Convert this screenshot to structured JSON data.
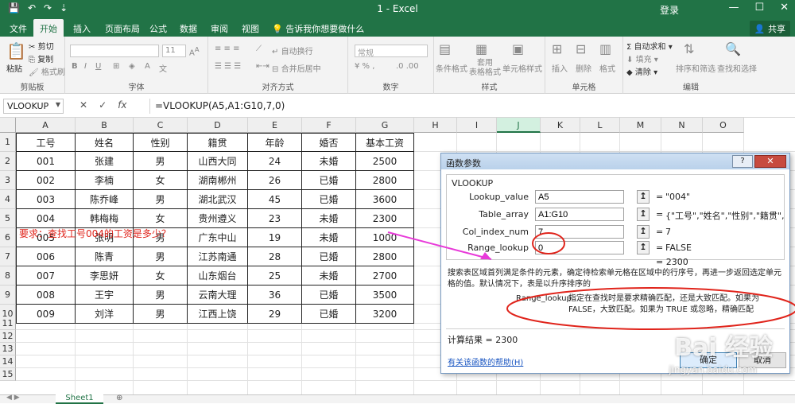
{
  "titlebar": {
    "title": "1  -  Excel",
    "login": "登录",
    "min": "—",
    "max": "☐",
    "close": "✕",
    "save": "💾",
    "undo": "↶",
    "redo": "↷",
    "more": "⇣"
  },
  "tabs": [
    "文件",
    "开始",
    "插入",
    "页面布局",
    "公式",
    "数据",
    "审阅",
    "视图"
  ],
  "tell_me": "告诉我你想要做什么",
  "share": "共享",
  "ribbon": {
    "clipboard": {
      "label": "剪贴板",
      "paste": "粘贴",
      "cut": "剪切",
      "copy": "复制",
      "format_painter": "格式刷"
    },
    "font": {
      "label": "字体",
      "size": "11"
    },
    "alignment": {
      "label": "对齐方式",
      "wrap": "自动换行",
      "merge": "合并后居中"
    },
    "number": {
      "label": "数字",
      "format": "常规"
    },
    "styles": {
      "label": "样式",
      "cond": "条件格式",
      "table": "套用\n表格格式",
      "cell": "单元格样式"
    },
    "cells": {
      "label": "单元格",
      "insert": "插入",
      "delete": "删除",
      "format": "格式"
    },
    "editing": {
      "label": "编辑",
      "autosum": "自动求和",
      "fill": "填充",
      "clear": "清除",
      "sort": "排序和筛选",
      "find": "查找和选择"
    }
  },
  "formula_bar": {
    "name_box": "VLOOKUP",
    "formula": "=VLOOKUP(A5,A1:G10,7,0)"
  },
  "columns": [
    "A",
    "B",
    "C",
    "D",
    "E",
    "F",
    "G",
    "H",
    "I",
    "J",
    "K",
    "L",
    "M",
    "N",
    "O"
  ],
  "rows": [
    "1",
    "2",
    "3",
    "4",
    "5",
    "6",
    "7",
    "8",
    "9",
    "10",
    "11",
    "12",
    "13",
    "14",
    "15"
  ],
  "table": {
    "headers": [
      "工号",
      "姓名",
      "性别",
      "籍贯",
      "年龄",
      "婚否",
      "基本工资"
    ],
    "rows": [
      [
        "001",
        "张建",
        "男",
        "山西大同",
        "24",
        "未婚",
        "2500"
      ],
      [
        "002",
        "李楠",
        "女",
        "湖南郴州",
        "26",
        "已婚",
        "2800"
      ],
      [
        "003",
        "陈乔峰",
        "男",
        "湖北武汉",
        "45",
        "已婚",
        "3600"
      ],
      [
        "004",
        "韩梅梅",
        "女",
        "贵州遵义",
        "23",
        "未婚",
        "2300"
      ],
      [
        "005",
        "张明",
        "男",
        "广东中山",
        "19",
        "未婚",
        "1000"
      ],
      [
        "006",
        "陈青",
        "男",
        "江苏南通",
        "28",
        "已婚",
        "2800"
      ],
      [
        "007",
        "李思妍",
        "女",
        "山东烟台",
        "25",
        "未婚",
        "2700"
      ],
      [
        "008",
        "王宇",
        "男",
        "云南大理",
        "36",
        "已婚",
        "3500"
      ],
      [
        "009",
        "刘洋",
        "男",
        "江西上饶",
        "29",
        "已婚",
        "3200"
      ]
    ]
  },
  "requirement": "要求：查找工号004的工资是多少？",
  "sheet_tab": "Sheet1",
  "dialog": {
    "title": "函数参数",
    "help_btn": "?",
    "close_btn": "✕",
    "function": "VLOOKUP",
    "args": [
      {
        "label": "Lookup_value",
        "input": "A5",
        "value": "\"004\""
      },
      {
        "label": "Table_array",
        "input": "A1:G10",
        "value": "{\"工号\",\"姓名\",\"性别\",\"籍贯\",\"年龄\",\"婚否\"}"
      },
      {
        "label": "Col_index_num",
        "input": "7",
        "value": "7"
      },
      {
        "label": "Range_lookup",
        "input": "0",
        "value": "FALSE"
      }
    ],
    "collapse_icon": "↥",
    "eq": "=",
    "result_line": "= 2300",
    "description": "搜索表区域首列满足条件的元素，确定待检索单元格在区域中的行序号，再进一步返回选定单元格的值。默认情况下，表是以升序排序的",
    "arg_desc_name": "Range_lookup",
    "arg_desc": "指定在查找时是要求精确匹配，还是大致匹配。如果为 FALSE，大致匹配。如果为 TRUE 或忽略，精确匹配",
    "calc_result": "计算结果 =   2300",
    "help_link": "有关该函数的帮助(H)",
    "ok": "确定",
    "cancel": "取消"
  },
  "watermark": {
    "brand": "Bai 经验",
    "url": "jingyan.baidu.com"
  },
  "annotation_colors": {
    "arrow": "#e83ad9",
    "circle": "#e0241b"
  }
}
